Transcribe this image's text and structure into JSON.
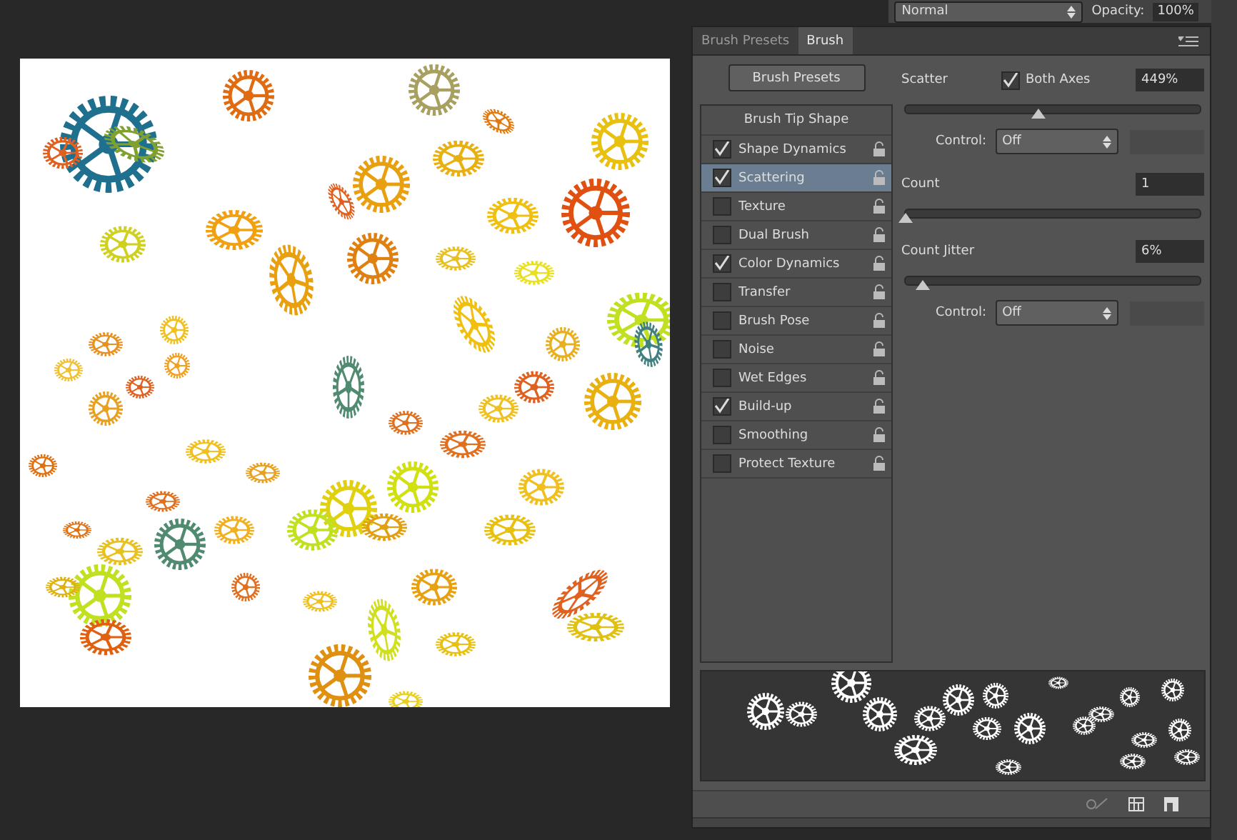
{
  "top_bar": {
    "blend_mode": "Normal",
    "opacity_label": "Opacity:",
    "opacity_value": "100%"
  },
  "tabs": [
    {
      "label": "Brush Presets",
      "selected": false
    },
    {
      "label": "Brush",
      "selected": true
    }
  ],
  "brush_presets_button": "Brush Presets",
  "options_header": "Brush Tip Shape",
  "options": [
    {
      "label": "Shape Dynamics",
      "checked": true,
      "selected": false
    },
    {
      "label": "Scattering",
      "checked": true,
      "selected": true
    },
    {
      "label": "Texture",
      "checked": false,
      "selected": false
    },
    {
      "label": "Dual Brush",
      "checked": false,
      "selected": false
    },
    {
      "label": "Color Dynamics",
      "checked": true,
      "selected": false
    },
    {
      "label": "Transfer",
      "checked": false,
      "selected": false
    },
    {
      "label": "Brush Pose",
      "checked": false,
      "selected": false
    },
    {
      "label": "Noise",
      "checked": false,
      "selected": false
    },
    {
      "label": "Wet Edges",
      "checked": false,
      "selected": false
    },
    {
      "label": "Build-up",
      "checked": true,
      "selected": false
    },
    {
      "label": "Smoothing",
      "checked": false,
      "selected": false
    },
    {
      "label": "Protect Texture",
      "checked": false,
      "selected": false
    }
  ],
  "settings": [
    {
      "kind": "slider",
      "label": "Scatter",
      "value": "449%",
      "level": 0.45,
      "both_axes": {
        "label": "Both Axes",
        "checked": true
      }
    },
    {
      "kind": "control",
      "label": "Control:",
      "value": "Off"
    },
    {
      "kind": "slider",
      "label": "Count",
      "value": "1",
      "level": 0
    },
    {
      "kind": "slider",
      "label": "Count Jitter",
      "value": "6%",
      "level": 0.06
    },
    {
      "kind": "control",
      "label": "Control:",
      "value": "Off"
    }
  ]
}
